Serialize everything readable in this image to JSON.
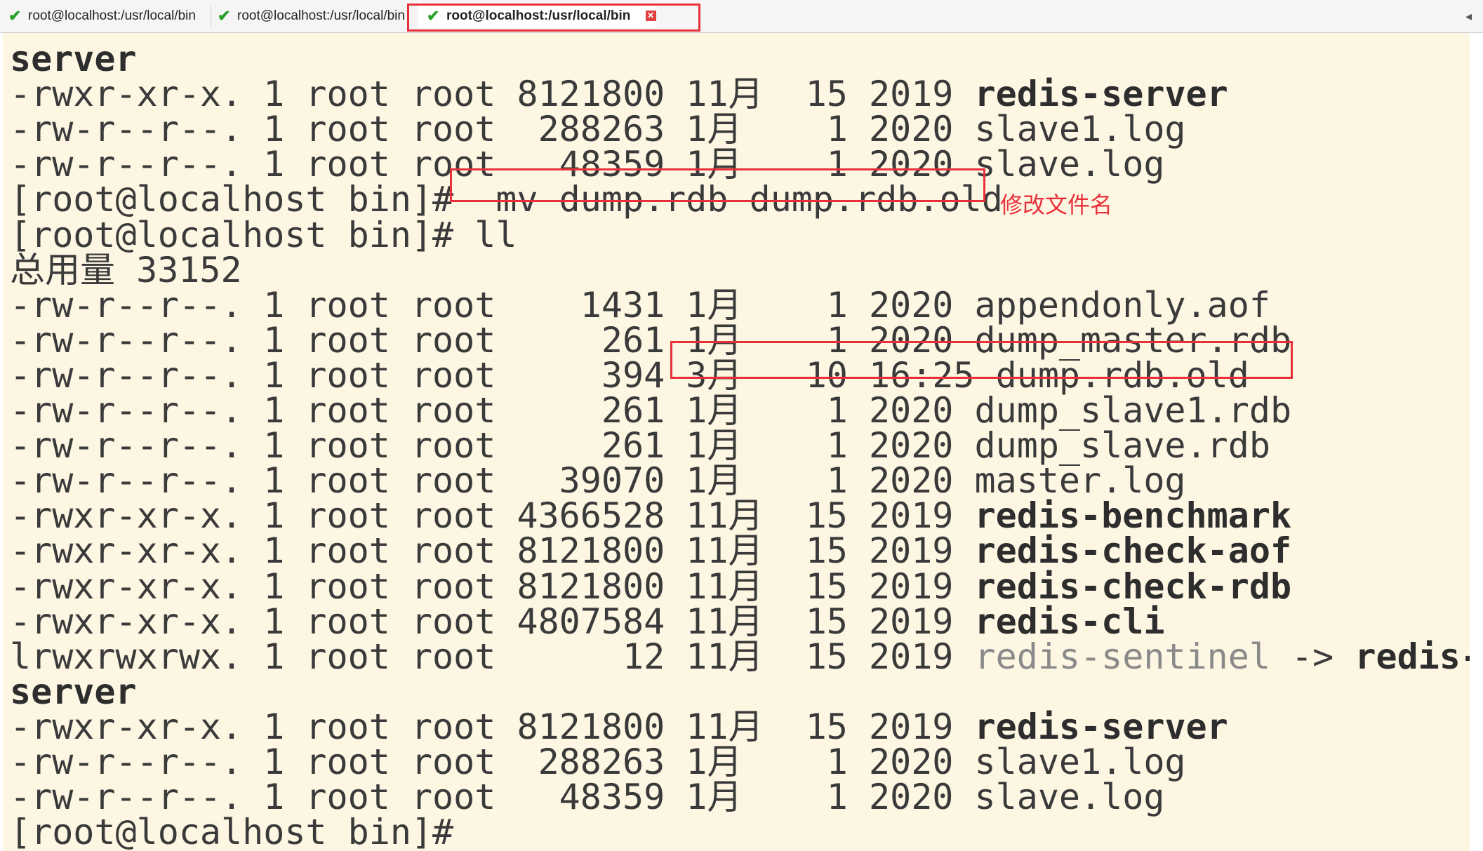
{
  "tabs": [
    {
      "label": "root@localhost:/usr/local/bin",
      "active": false
    },
    {
      "label": "root@localhost:/usr/local/bin",
      "active": false
    },
    {
      "label": "root@localhost:/usr/local/bin",
      "active": true
    }
  ],
  "colors": {
    "terminal_bg": "#fdf6e3",
    "highlight": "#e8303a",
    "check": "#2aa12a"
  },
  "terminal": {
    "lines": [
      {
        "parts": [
          {
            "t": "server",
            "s": "b"
          }
        ]
      },
      {
        "parts": [
          {
            "t": "-rwxr-xr-x. 1 root root 8121800 11月  15 2019 "
          },
          {
            "t": "redis-server",
            "s": "b"
          }
        ]
      },
      {
        "parts": [
          {
            "t": "-rw-r--r--. 1 root root  288263 1月    1 2020 slave1.log"
          }
        ]
      },
      {
        "parts": [
          {
            "t": "-rw-r--r--. 1 root root   48359 1月    1 2020 slave.log"
          }
        ]
      },
      {
        "parts": [
          {
            "t": "[root@localhost bin]#  mv dump.rdb dump.rdb.old"
          }
        ]
      },
      {
        "parts": [
          {
            "t": "[root@localhost bin]# ll"
          }
        ]
      },
      {
        "parts": [
          {
            "t": "总用量 33152"
          }
        ]
      },
      {
        "parts": [
          {
            "t": "-rw-r--r--. 1 root root    1431 1月    1 2020 appendonly.aof"
          }
        ]
      },
      {
        "parts": [
          {
            "t": "-rw-r--r--. 1 root root     261 1月    1 2020 dump_master.rdb"
          }
        ]
      },
      {
        "parts": [
          {
            "t": "-rw-r--r--. 1 root root     394 3月   10 16:25 dump.rdb.old"
          }
        ]
      },
      {
        "parts": [
          {
            "t": "-rw-r--r--. 1 root root     261 1月    1 2020 dump_slave1.rdb"
          }
        ]
      },
      {
        "parts": [
          {
            "t": "-rw-r--r--. 1 root root     261 1月    1 2020 dump_slave.rdb"
          }
        ]
      },
      {
        "parts": [
          {
            "t": "-rw-r--r--. 1 root root   39070 1月    1 2020 master.log"
          }
        ]
      },
      {
        "parts": [
          {
            "t": "-rwxr-xr-x. 1 root root 4366528 11月  15 2019 "
          },
          {
            "t": "redis-benchmark",
            "s": "b"
          }
        ]
      },
      {
        "parts": [
          {
            "t": "-rwxr-xr-x. 1 root root 8121800 11月  15 2019 "
          },
          {
            "t": "redis-check-aof",
            "s": "b"
          }
        ]
      },
      {
        "parts": [
          {
            "t": "-rwxr-xr-x. 1 root root 8121800 11月  15 2019 "
          },
          {
            "t": "redis-check-rdb",
            "s": "b"
          }
        ]
      },
      {
        "parts": [
          {
            "t": "-rwxr-xr-x. 1 root root 4807584 11月  15 2019 "
          },
          {
            "t": "redis-cli",
            "s": "b"
          }
        ]
      },
      {
        "parts": [
          {
            "t": "lrwxrwxrwx. 1 root root      12 11月  15 2019 "
          },
          {
            "t": "redis-sentinel",
            "s": "g"
          },
          {
            "t": " -> "
          },
          {
            "t": "redis-",
            "s": "b"
          }
        ]
      },
      {
        "parts": [
          {
            "t": "server",
            "s": "b"
          }
        ]
      },
      {
        "parts": [
          {
            "t": "-rwxr-xr-x. 1 root root 8121800 11月  15 2019 "
          },
          {
            "t": "redis-server",
            "s": "b"
          }
        ]
      },
      {
        "parts": [
          {
            "t": "-rw-r--r--. 1 root root  288263 1月    1 2020 slave1.log"
          }
        ]
      },
      {
        "parts": [
          {
            "t": "-rw-r--r--. 1 root root   48359 1月    1 2020 slave.log"
          }
        ]
      },
      {
        "parts": [
          {
            "t": "[root@localhost bin]#"
          }
        ]
      }
    ]
  },
  "annotation": {
    "label": "修改文件名"
  }
}
